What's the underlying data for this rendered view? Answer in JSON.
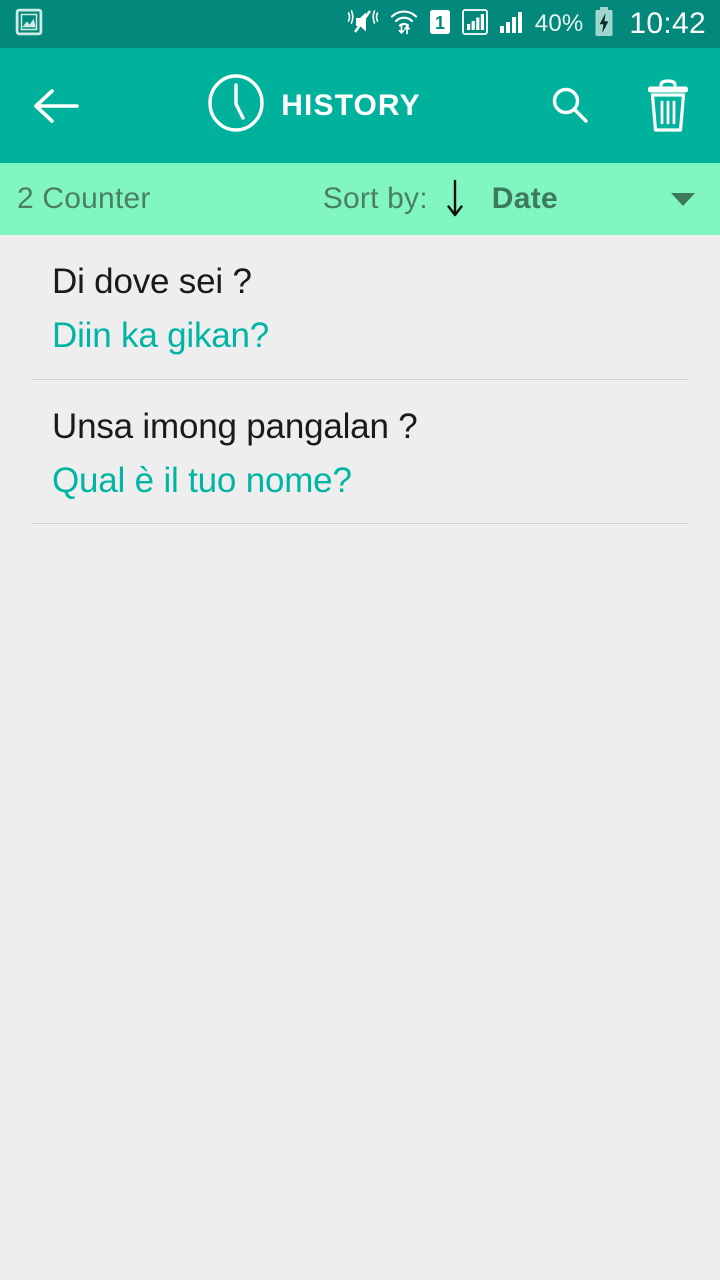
{
  "status_bar": {
    "icons": [
      {
        "name": "screenshot-image-icon",
        "label": "image"
      },
      {
        "name": "sound-mute-vibrate-icon",
        "label": "mute"
      },
      {
        "name": "wifi-icon",
        "label": "wifi"
      },
      {
        "name": "sim-1-icon",
        "label": "1"
      },
      {
        "name": "signal-sim1-icon",
        "label": "signal"
      },
      {
        "name": "signal-sim2-icon",
        "label": "signal"
      }
    ],
    "battery_percent": "40%",
    "battery_state": "charging",
    "time": "10:42"
  },
  "toolbar": {
    "back_label": "Back",
    "title": "HISTORY",
    "title_icon": "clock-icon",
    "search_label": "Search",
    "delete_label": "Delete all"
  },
  "sort_bar": {
    "counter": "2 Counter",
    "sort_label": "Sort by:",
    "direction": "descending",
    "sort_value": "Date",
    "dropdown_label": "Open sort menu"
  },
  "history": {
    "items": [
      {
        "primary": "Di dove sei ?",
        "secondary": "Diin ka gikan?"
      },
      {
        "primary": "Unsa imong pangalan ?",
        "secondary": "Qual è il tuo nome?"
      }
    ]
  },
  "colors": {
    "status_bar": "#03897B",
    "toolbar": "#00B29B",
    "sort_bar": "#82F6C0",
    "background": "#EEEEEE",
    "accent_teal": "#00B5A3",
    "sort_text": "#4A7F63",
    "sort_value_text": "#3C7A5B",
    "primary_text": "#1A1A1A",
    "divider": "#CFCFCF"
  }
}
